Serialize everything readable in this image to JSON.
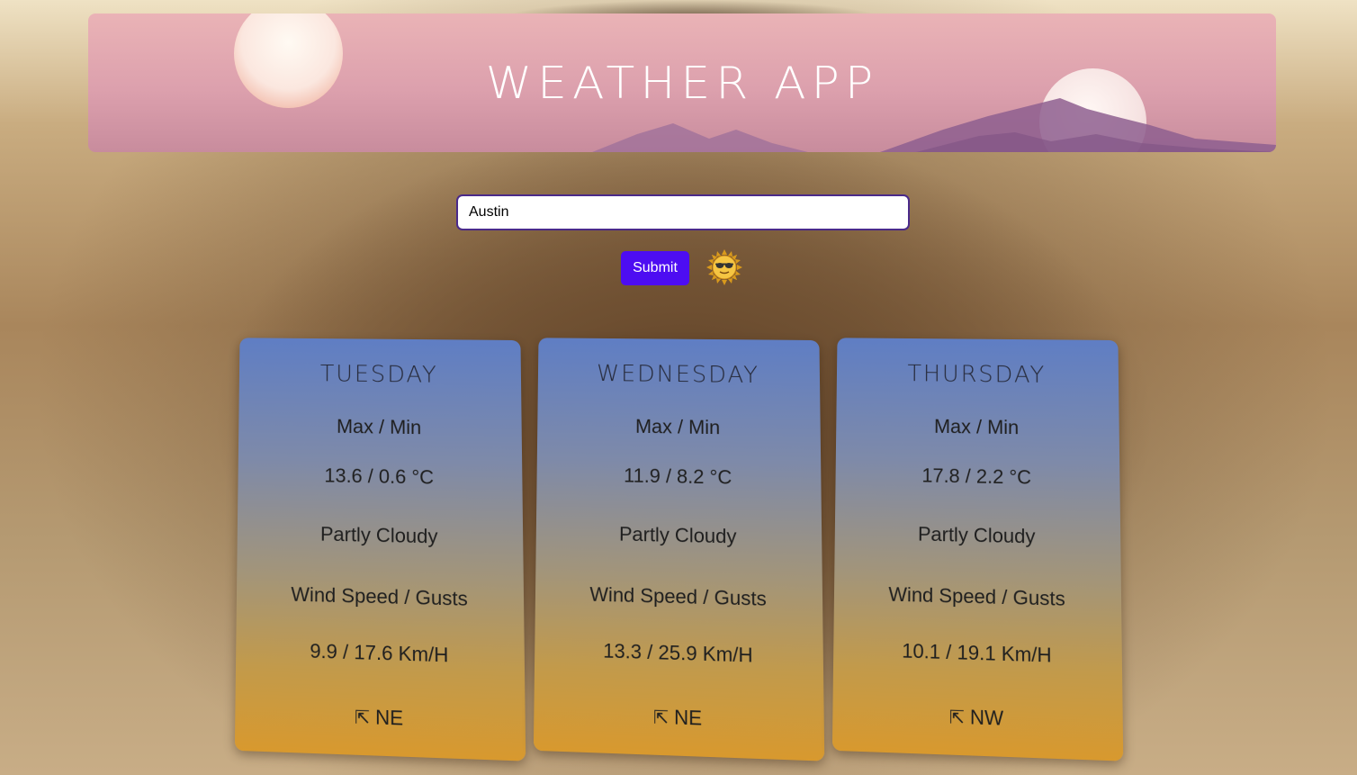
{
  "header": {
    "title": "WEATHER APP"
  },
  "search": {
    "value": "Austin",
    "submit_label": "Submit"
  },
  "icons": {
    "sun": "sun-with-sunglasses-icon",
    "direction": "arrow-up-left-icon"
  },
  "colors": {
    "submit": "#4d0df2",
    "card_top": "#5f7ec4",
    "card_bottom": "#d8992e",
    "header": "#e3a9b3"
  },
  "forecast": [
    {
      "day": "Tuesday",
      "maxmin_label": "Max / Min",
      "temp": "13.6 / 0.6",
      "unit": "°C",
      "condition": "Partly Cloudy",
      "wind_label": "Wind Speed / Gusts",
      "wind": "9.9 / 17.6 Km/H",
      "arrow": "⇱",
      "direction": "NE"
    },
    {
      "day": "Wednesday",
      "maxmin_label": "Max / Min",
      "temp": "11.9 / 8.2",
      "unit": "°C",
      "condition": "Partly Cloudy",
      "wind_label": "Wind Speed / Gusts",
      "wind": "13.3 / 25.9 Km/H",
      "arrow": "⇱",
      "direction": "NE"
    },
    {
      "day": "Thursday",
      "maxmin_label": "Max / Min",
      "temp": "17.8 / 2.2",
      "unit": "°C",
      "condition": "Partly Cloudy",
      "wind_label": "Wind Speed / Gusts",
      "wind": "10.1 / 19.1 Km/H",
      "arrow": "⇱",
      "direction": "NW"
    }
  ]
}
